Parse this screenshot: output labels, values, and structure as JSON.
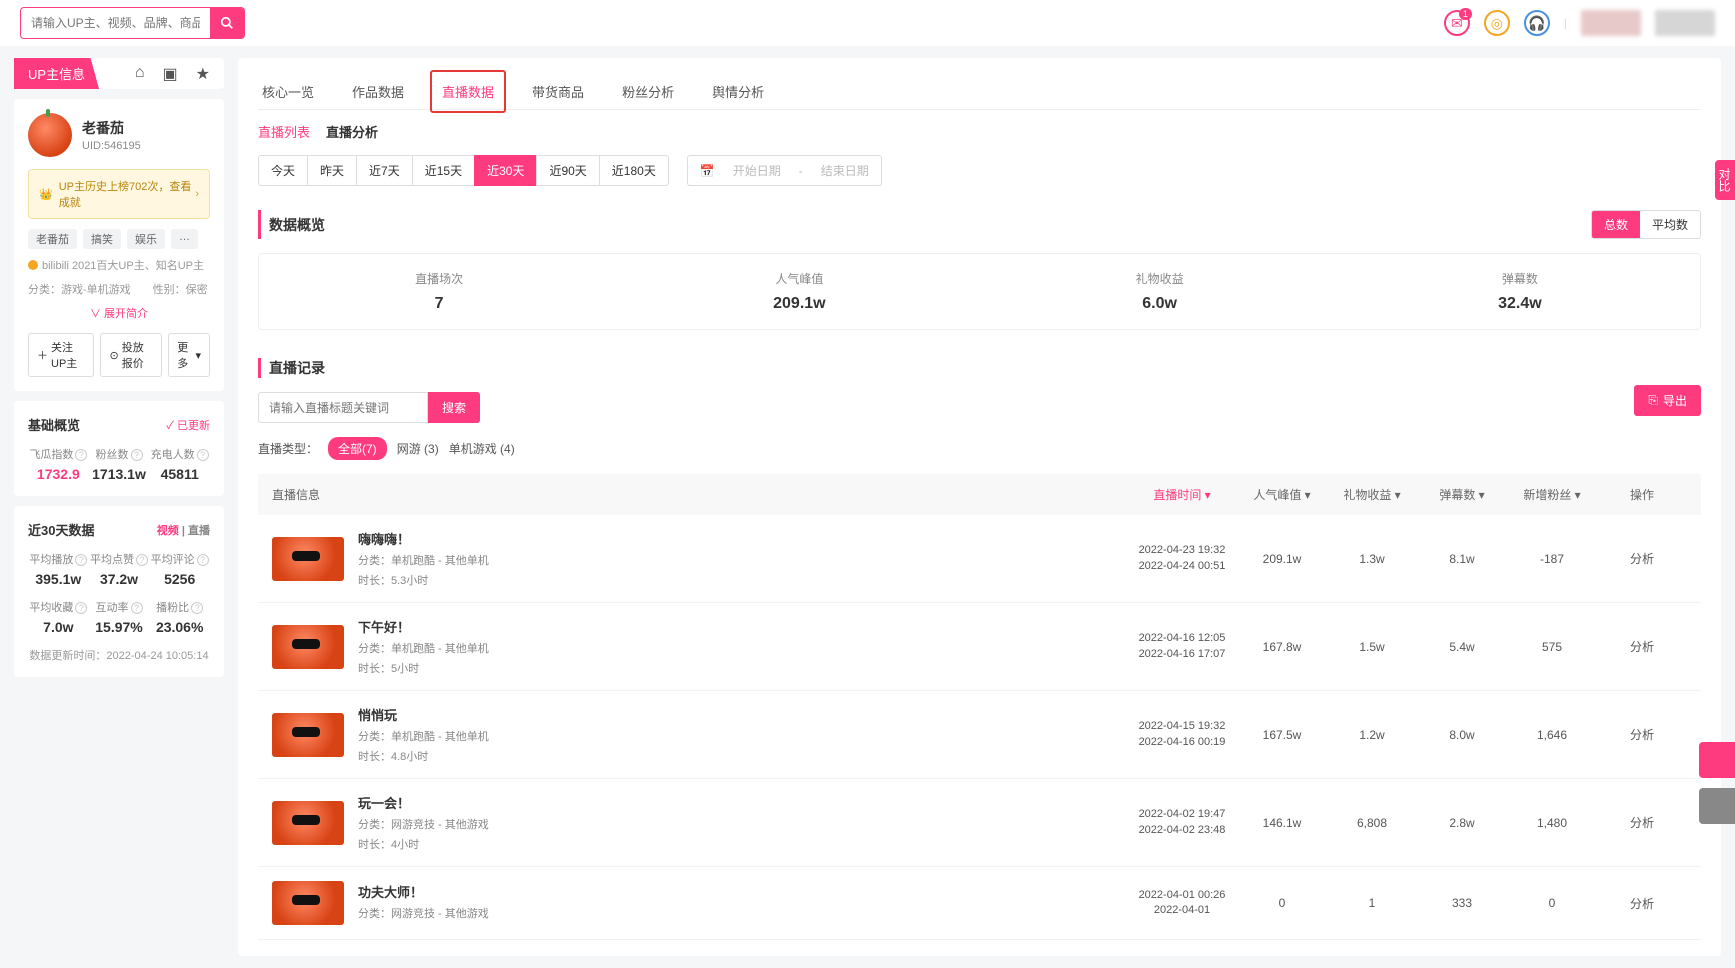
{
  "header": {
    "search_placeholder": "请输入UP主、视频、品牌、商品关键词搜索",
    "mail_badge": "1"
  },
  "sidebar": {
    "tab_label": "UP主信息",
    "profile": {
      "name": "老番茄",
      "uid": "UID:546195"
    },
    "banner": "UP主历史上榜702次，查看成就",
    "tags": [
      "老番茄",
      "搞笑",
      "娱乐",
      "…"
    ],
    "badge_line": "bilibili 2021百大UP主、知名UP主",
    "class_line": "分类：游戏-单机游戏　　性别：保密",
    "expand": "∨ 展开简介",
    "btns": {
      "follow": "关注UP主",
      "quote": "投放报价",
      "more": "更多"
    },
    "basic": {
      "title": "基础概览",
      "updated": "✓ 已更新",
      "items": [
        {
          "lbl": "飞瓜指数",
          "val": "1732.9",
          "pink": true
        },
        {
          "lbl": "粉丝数",
          "val": "1713.1w"
        },
        {
          "lbl": "充电人数",
          "val": "45811"
        }
      ]
    },
    "d30": {
      "title": "近30天数据",
      "tabs": {
        "video": "视频",
        "live": "直播"
      },
      "rows": [
        [
          {
            "lbl": "平均播放",
            "val": "395.1w"
          },
          {
            "lbl": "平均点赞",
            "val": "37.2w"
          },
          {
            "lbl": "平均评论",
            "val": "5256"
          }
        ],
        [
          {
            "lbl": "平均收藏",
            "val": "7.0w"
          },
          {
            "lbl": "互动率",
            "val": "15.97%"
          },
          {
            "lbl": "播粉比",
            "val": "23.06%"
          }
        ]
      ],
      "ts_label": "数据更新时间：",
      "ts": "2022-04-24 10:05:14"
    }
  },
  "main": {
    "tabs": [
      "核心一览",
      "作品数据",
      "直播数据",
      "带货商品",
      "粉丝分析",
      "舆情分析"
    ],
    "active_tab": 2,
    "subnav": {
      "list": "直播列表",
      "analysis": "直播分析"
    },
    "ranges": [
      "今天",
      "昨天",
      "近7天",
      "近15天",
      "近30天",
      "近90天",
      "近180天"
    ],
    "range_active": 4,
    "date": {
      "start": "开始日期",
      "end": "结束日期"
    },
    "overview": {
      "title": "数据概览",
      "toggle": {
        "total": "总数",
        "avg": "平均数"
      },
      "items": [
        {
          "lbl": "直播场次",
          "val": "7"
        },
        {
          "lbl": "人气峰值",
          "val": "209.1w"
        },
        {
          "lbl": "礼物收益",
          "val": "6.0w"
        },
        {
          "lbl": "弹幕数",
          "val": "32.4w"
        }
      ]
    },
    "records": {
      "title": "直播记录",
      "search_ph": "请输入直播标题关键词",
      "search_btn": "搜索",
      "export": "导出",
      "type_label": "直播类型：",
      "types": [
        {
          "t": "全部(7)",
          "on": true
        },
        {
          "t": "网游 (3)"
        },
        {
          "t": "单机游戏 (4)"
        }
      ],
      "columns": [
        "直播信息",
        "直播时间",
        "人气峰值",
        "礼物收益",
        "弹幕数",
        "新增粉丝",
        "操作"
      ],
      "sort_active": 1,
      "rows": [
        {
          "title": "嗨嗨嗨！",
          "cat": "分类：单机跑酷 - 其他单机",
          "dur": "时长：5.3小时",
          "start": "2022-04-23 19:32",
          "end": "2022-04-24 00:51",
          "peak": "209.1w",
          "gift": "1.3w",
          "dm": "8.1w",
          "fans": "-187",
          "op": "分析"
        },
        {
          "title": "下午好！",
          "cat": "分类：单机跑酷 - 其他单机",
          "dur": "时长：5小时",
          "start": "2022-04-16 12:05",
          "end": "2022-04-16 17:07",
          "peak": "167.8w",
          "gift": "1.5w",
          "dm": "5.4w",
          "fans": "575",
          "op": "分析"
        },
        {
          "title": "悄悄玩",
          "cat": "分类：单机跑酷 - 其他单机",
          "dur": "时长：4.8小时",
          "start": "2022-04-15 19:32",
          "end": "2022-04-16 00:19",
          "peak": "167.5w",
          "gift": "1.2w",
          "dm": "8.0w",
          "fans": "1,646",
          "op": "分析"
        },
        {
          "title": "玩一会！",
          "cat": "分类：网游竞技 - 其他游戏",
          "dur": "时长：4小时",
          "start": "2022-04-02 19:47",
          "end": "2022-04-02 23:48",
          "peak": "146.1w",
          "gift": "6,808",
          "dm": "2.8w",
          "fans": "1,480",
          "op": "分析"
        },
        {
          "title": "功夫大师！",
          "cat": "分类：网游竞技 - 其他游戏",
          "dur": "",
          "start": "2022-04-01 00:26",
          "end": "2022-04-01",
          "peak": "0",
          "gift": "1",
          "dm": "333",
          "fans": "0",
          "op": "分析"
        }
      ]
    }
  },
  "side_tab": "对比"
}
